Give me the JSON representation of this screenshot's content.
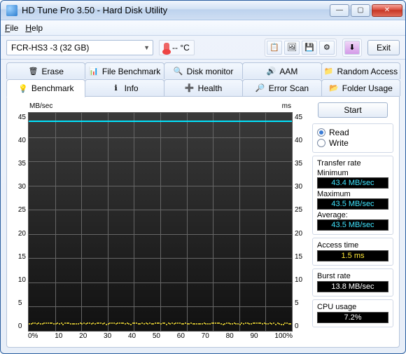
{
  "window": {
    "title": "HD Tune Pro 3.50 - Hard Disk Utility"
  },
  "menu": {
    "file": "File",
    "help": "Help"
  },
  "toolbar": {
    "drive": "FCR-HS3     -3 (32 GB)",
    "temp": "-- °C",
    "exit": "Exit"
  },
  "tabs_top": [
    {
      "label": "Erase",
      "icon": "🗑"
    },
    {
      "label": "File Benchmark",
      "icon": "📊"
    },
    {
      "label": "Disk monitor",
      "icon": "🔍"
    },
    {
      "label": "AAM",
      "icon": "🔊"
    },
    {
      "label": "Random Access",
      "icon": "📁"
    }
  ],
  "tabs_bottom": [
    {
      "label": "Benchmark",
      "icon": "💡",
      "active": true
    },
    {
      "label": "Info",
      "icon": "ℹ",
      "active": false
    },
    {
      "label": "Health",
      "icon": "➕",
      "active": false
    },
    {
      "label": "Error Scan",
      "icon": "🔎",
      "active": false
    },
    {
      "label": "Folder Usage",
      "icon": "📂",
      "active": false
    }
  ],
  "side": {
    "start": "Start",
    "read": "Read",
    "write": "Write",
    "transfer_title": "Transfer rate",
    "min_label": "Minimum",
    "min_val": "43.4 MB/sec",
    "max_label": "Maximum",
    "max_val": "43.5 MB/sec",
    "avg_label": "Average:",
    "avg_val": "43.5 MB/sec",
    "access_title": "Access time",
    "access_val": "1.5 ms",
    "burst_title": "Burst rate",
    "burst_val": "13.8 MB/sec",
    "cpu_title": "CPU usage",
    "cpu_val": "7.2%"
  },
  "chart_data": {
    "type": "line",
    "title_left": "MB/sec",
    "title_right": "ms",
    "y_range": [
      0,
      45
    ],
    "y_ticks": [
      45,
      40,
      35,
      30,
      25,
      20,
      15,
      10,
      5,
      0
    ],
    "x_range": [
      0,
      100
    ],
    "x_ticks": [
      "0%",
      "10",
      "20",
      "30",
      "40",
      "50",
      "60",
      "70",
      "80",
      "90",
      "100%"
    ],
    "series": [
      {
        "name": "transfer_rate_MBps",
        "color": "#00e5ff",
        "approx_constant": 43.4
      },
      {
        "name": "access_time_ms",
        "color": "#ffe838",
        "approx_constant": 1.5
      }
    ]
  }
}
